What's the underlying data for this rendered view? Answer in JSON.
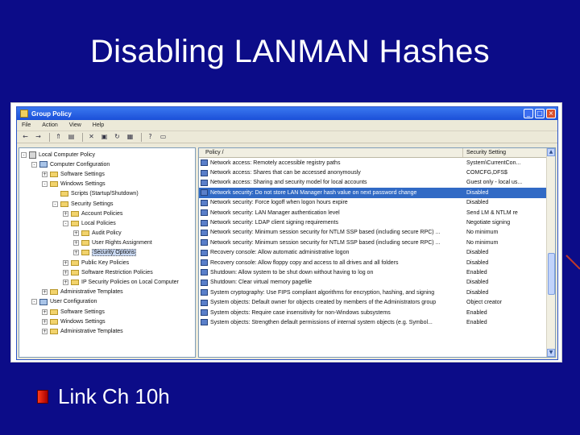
{
  "slide": {
    "title": "Disabling LANMAN Hashes",
    "bullet": "Link Ch 10h"
  },
  "window": {
    "title": "Group Policy",
    "menu": [
      "File",
      "Action",
      "View",
      "Help"
    ]
  },
  "tree": [
    {
      "label": "Local Computer Policy",
      "depth": 0,
      "exp": "-",
      "icon": "policy"
    },
    {
      "label": "Computer Configuration",
      "depth": 1,
      "exp": "-",
      "icon": "computer"
    },
    {
      "label": "Software Settings",
      "depth": 2,
      "exp": "+",
      "icon": "folder"
    },
    {
      "label": "Windows Settings",
      "depth": 2,
      "exp": "-",
      "icon": "folder"
    },
    {
      "label": "Scripts (Startup/Shutdown)",
      "depth": 3,
      "exp": "",
      "icon": "folder"
    },
    {
      "label": "Security Settings",
      "depth": 3,
      "exp": "-",
      "icon": "folder"
    },
    {
      "label": "Account Policies",
      "depth": 4,
      "exp": "+",
      "icon": "folder"
    },
    {
      "label": "Local Policies",
      "depth": 4,
      "exp": "-",
      "icon": "folder"
    },
    {
      "label": "Audit Policy",
      "depth": 5,
      "exp": "+",
      "icon": "folder"
    },
    {
      "label": "User Rights Assignment",
      "depth": 5,
      "exp": "+",
      "icon": "folder"
    },
    {
      "label": "Security Options",
      "depth": 5,
      "exp": "+",
      "icon": "folder",
      "selected": true
    },
    {
      "label": "Public Key Policies",
      "depth": 4,
      "exp": "+",
      "icon": "folder"
    },
    {
      "label": "Software Restriction Policies",
      "depth": 4,
      "exp": "+",
      "icon": "folder"
    },
    {
      "label": "IP Security Policies on Local Computer",
      "depth": 4,
      "exp": "+",
      "icon": "folder"
    },
    {
      "label": "Administrative Templates",
      "depth": 2,
      "exp": "+",
      "icon": "folder"
    },
    {
      "label": "User Configuration",
      "depth": 1,
      "exp": "-",
      "icon": "computer"
    },
    {
      "label": "Software Settings",
      "depth": 2,
      "exp": "+",
      "icon": "folder"
    },
    {
      "label": "Windows Settings",
      "depth": 2,
      "exp": "+",
      "icon": "folder"
    },
    {
      "label": "Administrative Templates",
      "depth": 2,
      "exp": "+",
      "icon": "folder"
    }
  ],
  "list": {
    "headers": {
      "policy": "Policy",
      "setting": "Security Setting"
    },
    "rows": [
      {
        "policy": "Network access: Remotely accessible registry paths",
        "setting": "System\\CurrentCon..."
      },
      {
        "policy": "Network access: Shares that can be accessed anonymously",
        "setting": "COMCFG,DFS$"
      },
      {
        "policy": "Network access: Sharing and security model for local accounts",
        "setting": "Guest only - local us..."
      },
      {
        "policy": "Network security: Do not store LAN Manager hash value on next password change",
        "setting": "Disabled",
        "selected": true
      },
      {
        "policy": "Network security: Force logoff when logon hours expire",
        "setting": "Disabled"
      },
      {
        "policy": "Network security: LAN Manager authentication level",
        "setting": "Send LM & NTLM re"
      },
      {
        "policy": "Network security: LDAP client signing requirements",
        "setting": "Negotiate signing"
      },
      {
        "policy": "Network security: Minimum session security for NTLM SSP based (including secure RPC) ...",
        "setting": "No minimum"
      },
      {
        "policy": "Network security: Minimum session security for NTLM SSP based (including secure RPC) ...",
        "setting": "No minimum"
      },
      {
        "policy": "Recovery console: Allow automatic administrative logon",
        "setting": "Disabled"
      },
      {
        "policy": "Recovery console: Allow floppy copy and access to all drives and all folders",
        "setting": "Disabled"
      },
      {
        "policy": "Shutdown: Allow system to be shut down without having to log on",
        "setting": "Enabled"
      },
      {
        "policy": "Shutdown: Clear virtual memory pagefile",
        "setting": "Disabled"
      },
      {
        "policy": "System cryptography: Use FIPS compliant algorithms for encryption, hashing, and signing",
        "setting": "Disabled"
      },
      {
        "policy": "System objects: Default owner for objects created by members of the Administrators group",
        "setting": "Object creator"
      },
      {
        "policy": "System objects: Require case insensitivity for non-Windows subsystems",
        "setting": "Enabled"
      },
      {
        "policy": "System objects: Strengthen default permissions of internal system objects (e.g. Symbol...",
        "setting": "Enabled"
      }
    ]
  }
}
